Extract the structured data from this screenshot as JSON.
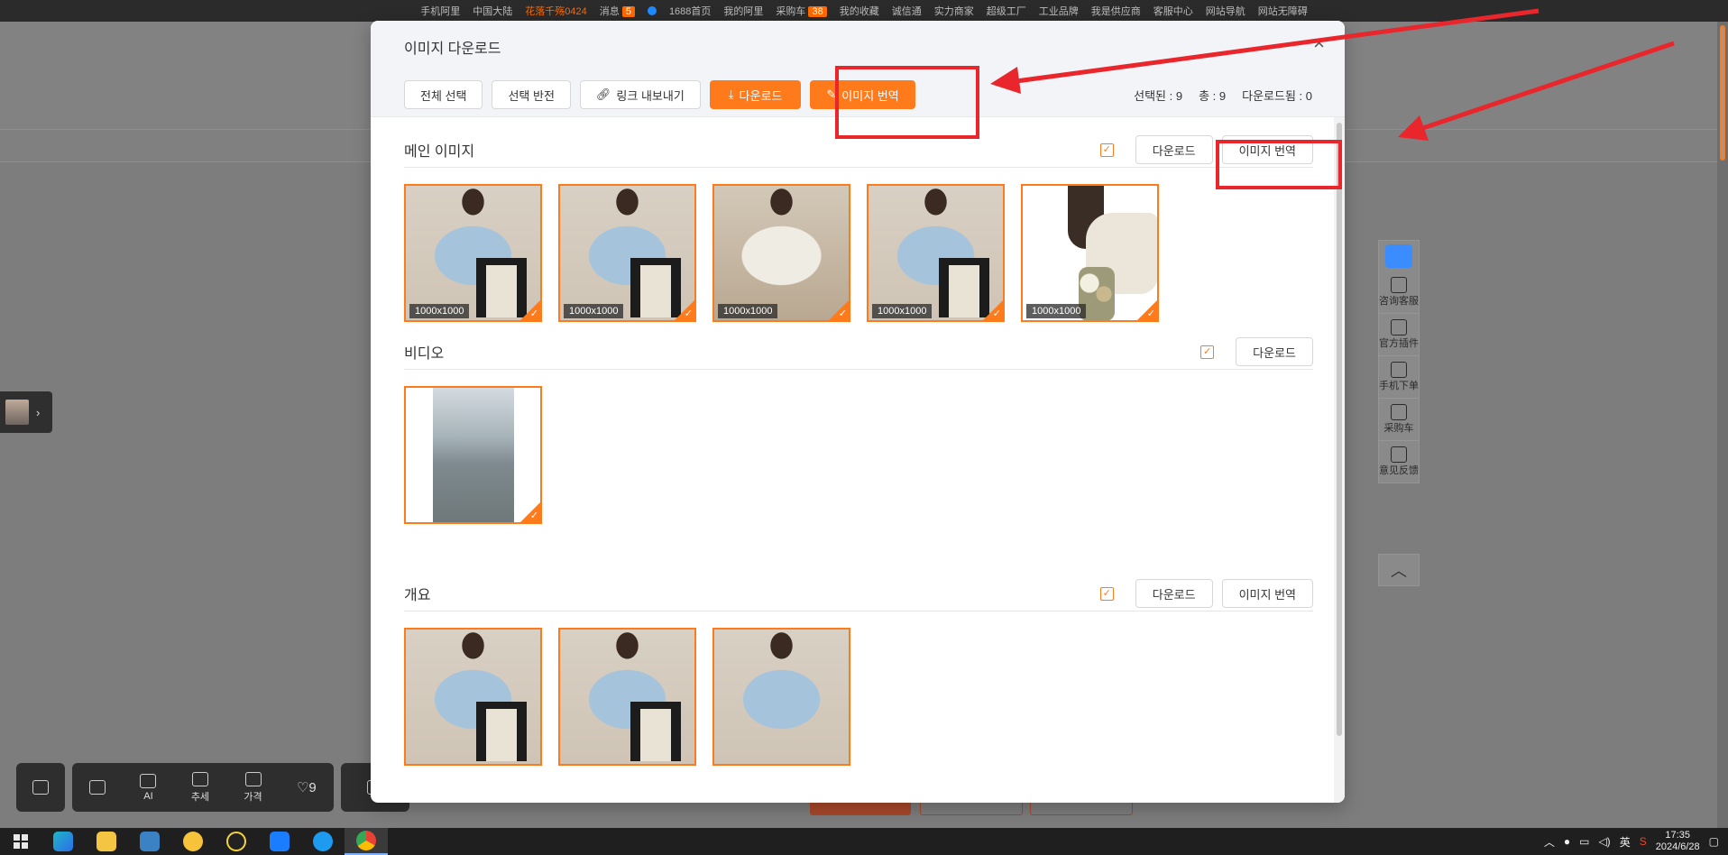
{
  "topbar": {
    "items": [
      "手机阿里",
      "中国大陆",
      "花落千殇0424",
      "消息",
      "5",
      "1688首页",
      "我的阿里",
      "采购车",
      "38",
      "我的收藏",
      "诚信通",
      "实力商家",
      "超级工厂",
      "工业品牌",
      "我是供应商",
      "客服中心",
      "网站导航",
      "网站无障碍"
    ]
  },
  "modal": {
    "title": "이미지 다운로드",
    "close_glyph": "×",
    "toolbar": {
      "select_all": "전체 선택",
      "invert_selection": "선택 반전",
      "export_links": "링크 내보내기",
      "download": "다운로드",
      "translate_images": "이미지 번역"
    },
    "stats": {
      "selected": "선택된 : 9",
      "total": "총 : 9",
      "downloaded": "다운로드됨 : 0"
    },
    "sections": {
      "main": {
        "title": "메인 이미지",
        "download": "다운로드",
        "translate": "이미지 번역",
        "sizes": [
          "1000x1000",
          "1000x1000",
          "1000x1000",
          "1000x1000",
          "1000x1000"
        ]
      },
      "video": {
        "title": "비디오",
        "download": "다운로드"
      },
      "overview": {
        "title": "개요",
        "download": "다운로드",
        "translate": "이미지 번역"
      }
    }
  },
  "side_toolbar": {
    "items": [
      "咨询客服",
      "官方插件",
      "手机下单",
      "采购车",
      "意见反馈"
    ]
  },
  "bottom_bar": {
    "ai": "AI",
    "trend": "추세",
    "price": "가격",
    "likes": "9"
  },
  "taskbar": {
    "ime": "英",
    "time": "17:35",
    "date": "2024/6/28"
  },
  "colors": {
    "accent": "#ff7a1a",
    "annotation": "#e8262c"
  }
}
